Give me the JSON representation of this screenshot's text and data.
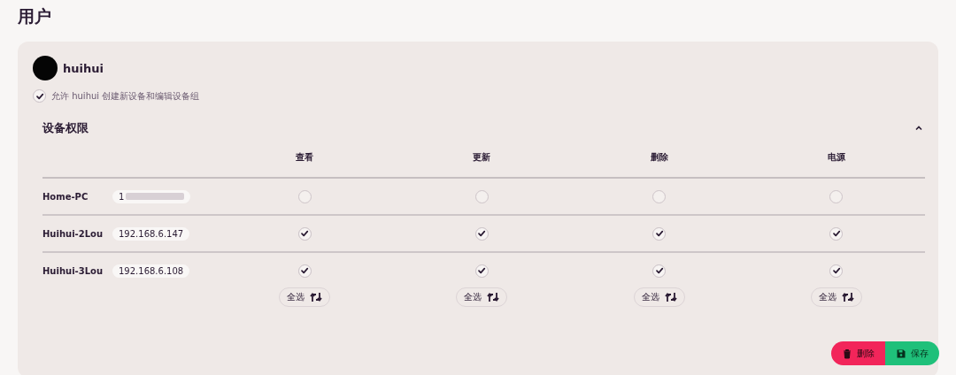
{
  "page_title": "用户",
  "user": {
    "name": "huihui"
  },
  "allow_option": {
    "label": "允许 huihui 创建新设备和编辑设备组",
    "checked": true
  },
  "permissions": {
    "title": "设备权限",
    "expanded": true,
    "columns": [
      "查看",
      "更新",
      "删除",
      "电源"
    ],
    "rows": [
      {
        "device": "Home-PC",
        "ip": "1",
        "ip_blurred": true,
        "checks": [
          false,
          false,
          false,
          false
        ]
      },
      {
        "device": "Huihui-2Lou",
        "ip": "192.168.6.147",
        "ip_blurred": false,
        "checks": [
          true,
          true,
          true,
          true
        ]
      },
      {
        "device": "Huihui-3Lou",
        "ip": "192.168.6.108",
        "ip_blurred": false,
        "checks": [
          true,
          true,
          true,
          true
        ]
      }
    ],
    "select_all": [
      "全选",
      "全选",
      "全选",
      "全选"
    ]
  },
  "actions": [
    {
      "kind": "delete",
      "label": "删除"
    },
    {
      "kind": "save",
      "label": "保存"
    }
  ]
}
